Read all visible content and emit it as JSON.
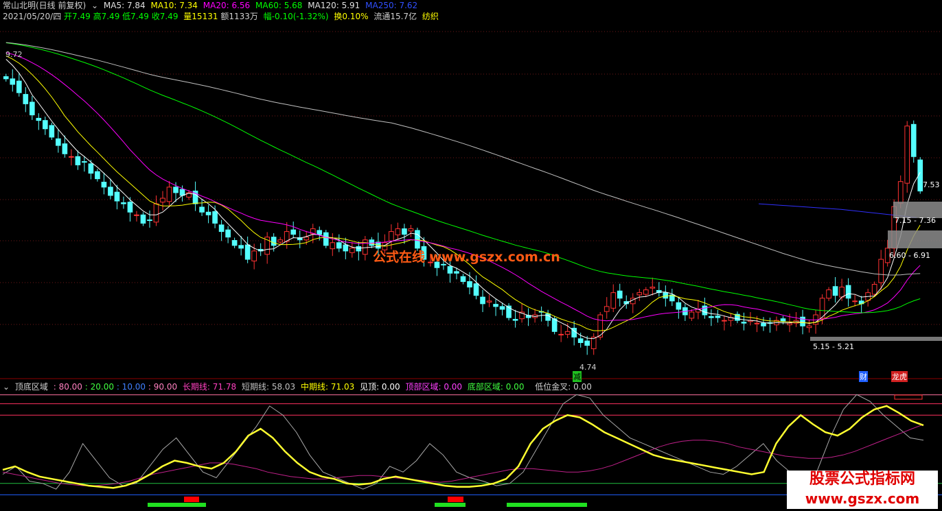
{
  "header": {
    "stock": "常山北明(日线 前复权)",
    "ma5": "MA5: 7.84",
    "ma10": "MA10: 7.34",
    "ma20": "MA20: 6.56",
    "ma60": "MA60: 5.68",
    "ma120": "MA120: 5.91",
    "ma250": "MA250: 7.62",
    "date": "2021/05/20/四",
    "open": "开7.49",
    "high": "高7.49",
    "low": "低7.49",
    "close": "收7.49",
    "vol": "量15131",
    "amount": "额1133万",
    "change": "幅-0.10(-1.32%)",
    "turnover": "换0.10%",
    "float": "流通15.7亿",
    "sector": "纺织"
  },
  "annotations": {
    "high": "9.72",
    "low": "4.74",
    "zone1": "7.15 - 7.36",
    "zone2": "6.60 - 6.91",
    "zone3": "5.15 - 5.21",
    "last": "7.53",
    "jian": "减",
    "cai": "财",
    "longhu": "龙虎"
  },
  "indicator_header": {
    "name": "顶底区域",
    "v80": ": 80.00",
    "v20": ": 20.00",
    "v10": ": 10.00",
    "v90": ": 90.00",
    "long": "长期线: 71.78",
    "short": "短期线: 58.03",
    "mid": "中期线: 71.03",
    "top": "见顶: 0.00",
    "topzone": "顶部区域: 0.00",
    "botzone": "底部区域: 0.00",
    "cross": "低位金叉: 0.00"
  },
  "watermark": {
    "main": "公式在线  www.gszx.com.cn",
    "corner1": "股票公式指标网",
    "corner2": "www.gszx.com"
  },
  "colors": {
    "up": "#ff3232",
    "down": "#54ffff",
    "ma5": "#ffffff",
    "ma10": "#ffff00",
    "ma20": "#ff00ff",
    "ma60": "#00ff00",
    "ma120": "#c0c0c0",
    "ma250": "#3030ff"
  },
  "chart_data": [
    {
      "type": "candlestick",
      "title": "常山北明(日线 前复权)",
      "ylim": [
        4.3,
        10.5
      ],
      "series": [
        {
          "name": "MA250",
          "values": [
            7.3,
            7.2,
            7.05
          ]
        },
        {
          "name": "Close",
          "values": [
            9.55,
            9.45,
            9.3,
            9.1,
            8.9,
            8.8,
            8.65,
            8.5,
            8.35,
            8.2,
            8.15,
            8.0,
            8.05,
            7.85,
            7.75,
            7.6,
            7.45,
            7.35,
            7.3,
            7.15,
            7.1,
            6.95,
            7.0,
            7.3,
            7.4,
            7.6,
            7.5,
            7.45,
            7.5,
            7.3,
            7.15,
            7.1,
            6.95,
            6.8,
            6.7,
            6.55,
            6.5,
            6.3,
            6.45,
            6.45,
            6.7,
            6.55,
            6.65,
            6.8,
            6.75,
            6.65,
            6.7,
            6.85,
            6.75,
            6.55,
            6.6,
            6.5,
            6.45,
            6.5,
            6.45,
            6.65,
            6.55,
            6.5,
            6.6,
            6.8,
            6.85,
            6.75,
            6.85,
            6.5,
            6.3,
            6.25,
            6.15,
            6.2,
            6.05,
            6.05,
            5.9,
            5.8,
            5.65,
            5.5,
            5.55,
            5.45,
            5.4,
            5.25,
            5.2,
            5.35,
            5.25,
            5.3,
            5.35,
            5.2,
            5.0,
            4.95,
            5.0,
            4.9,
            4.8,
            4.75,
            4.9,
            5.3,
            5.45,
            5.7,
            5.6,
            5.5,
            5.6,
            5.7,
            5.75,
            5.8,
            5.7,
            5.6,
            5.55,
            5.4,
            5.3,
            5.35,
            5.4,
            5.3,
            5.25,
            5.25,
            5.2,
            5.25,
            5.2,
            5.15,
            5.2,
            5.15,
            5.1,
            5.15,
            5.2,
            5.18,
            5.15,
            5.2,
            5.1,
            5.1,
            5.3,
            5.6,
            5.75,
            5.65,
            5.8,
            5.6,
            5.55,
            5.5,
            5.7,
            5.85,
            6.3,
            6.5,
            7.25,
            7.7,
            8.7,
            8.15,
            7.53
          ]
        }
      ],
      "xlabel": "",
      "ylabel": ""
    },
    {
      "type": "line",
      "title": "顶底区域",
      "ylim": [
        0,
        100
      ],
      "series": [
        {
          "name": "长期线",
          "values": [
            30,
            28,
            26,
            24,
            22,
            20,
            19,
            18,
            18,
            19,
            20,
            22,
            25,
            28,
            30,
            32,
            34,
            36,
            38,
            38,
            37,
            35,
            33,
            30,
            28,
            26,
            25,
            24,
            24,
            25,
            26,
            27,
            27,
            26,
            25,
            24,
            23,
            22,
            21,
            22,
            24,
            26,
            28,
            30,
            32,
            33,
            33,
            32,
            31,
            30,
            30,
            31,
            33,
            36,
            40,
            44,
            48,
            52,
            55,
            57,
            58,
            58,
            57,
            55,
            52,
            50,
            48,
            46,
            44,
            43,
            42,
            42,
            43,
            45,
            48,
            52,
            56,
            60,
            64,
            68,
            71.78
          ]
        },
        {
          "name": "短期线",
          "values": [
            28,
            35,
            22,
            20,
            15,
            30,
            55,
            40,
            25,
            18,
            20,
            35,
            50,
            60,
            45,
            30,
            25,
            40,
            55,
            70,
            88,
            80,
            65,
            45,
            30,
            25,
            20,
            15,
            20,
            35,
            30,
            40,
            55,
            45,
            30,
            25,
            22,
            18,
            20,
            30,
            50,
            70,
            90,
            98,
            95,
            80,
            70,
            60,
            55,
            50,
            45,
            40,
            35,
            30,
            28,
            35,
            45,
            55,
            40,
            30,
            25,
            30,
            60,
            85,
            98,
            92,
            80,
            70,
            60,
            58.03
          ]
        },
        {
          "name": "中期线",
          "values": [
            32,
            35,
            30,
            26,
            24,
            22,
            20,
            18,
            17,
            16,
            18,
            22,
            28,
            35,
            40,
            38,
            35,
            33,
            38,
            48,
            62,
            68,
            60,
            48,
            38,
            30,
            26,
            24,
            20,
            19,
            20,
            24,
            26,
            24,
            22,
            20,
            18,
            17,
            17,
            18,
            20,
            24,
            35,
            55,
            68,
            75,
            80,
            78,
            72,
            65,
            60,
            55,
            50,
            45,
            42,
            40,
            38,
            36,
            34,
            32,
            30,
            28,
            30,
            55,
            70,
            80,
            72,
            65,
            62,
            68,
            78,
            85,
            88,
            82,
            75,
            71.03
          ]
        }
      ],
      "xlabel": "",
      "ylabel": ""
    }
  ]
}
